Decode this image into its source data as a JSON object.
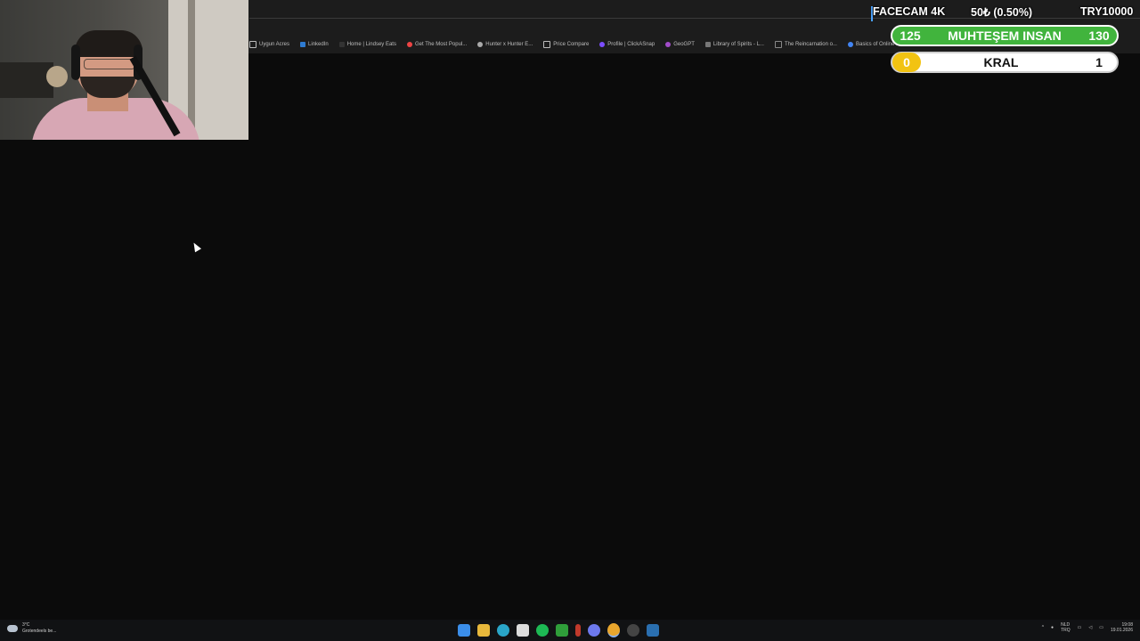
{
  "overlay": {
    "facecam_label": "FACECAM 4K",
    "donation_label": "50₺ (0.50%)",
    "goal_label": "TRY10000",
    "bar1": {
      "left": "125",
      "title": "MUHTEŞEM INSAN",
      "right": "130"
    },
    "bar2": {
      "left": "0",
      "title": "KRAL",
      "right": "1"
    }
  },
  "bookmarks": [
    {
      "label": "Uygun Acres",
      "icon": "folder-icon"
    },
    {
      "label": "LinkedIn",
      "icon": "linkedin-icon"
    },
    {
      "label": "Home | Lindsey Eats",
      "icon": "site-icon"
    },
    {
      "label": "Get The Most Popul...",
      "icon": "site-icon"
    },
    {
      "label": "Hunter x Hunter E...",
      "icon": "site-icon"
    },
    {
      "label": "Price Compare",
      "icon": "folder-icon"
    },
    {
      "label": "Profile | ClickASnap",
      "icon": "site-icon"
    },
    {
      "label": "GeoGPT",
      "icon": "site-icon"
    },
    {
      "label": "Library of Spirits - L...",
      "icon": "site-icon"
    },
    {
      "label": "The Reincarnation o...",
      "icon": "site-icon"
    },
    {
      "label": "Basics of Online M...",
      "icon": "google-icon"
    }
  ],
  "taskbar": {
    "weather_temp": "3°C",
    "weather_desc": "Grotendeels be...",
    "lang_top": "NLD",
    "lang_bottom": "TRQ",
    "time": "19:08",
    "date": "19.01.2026"
  }
}
